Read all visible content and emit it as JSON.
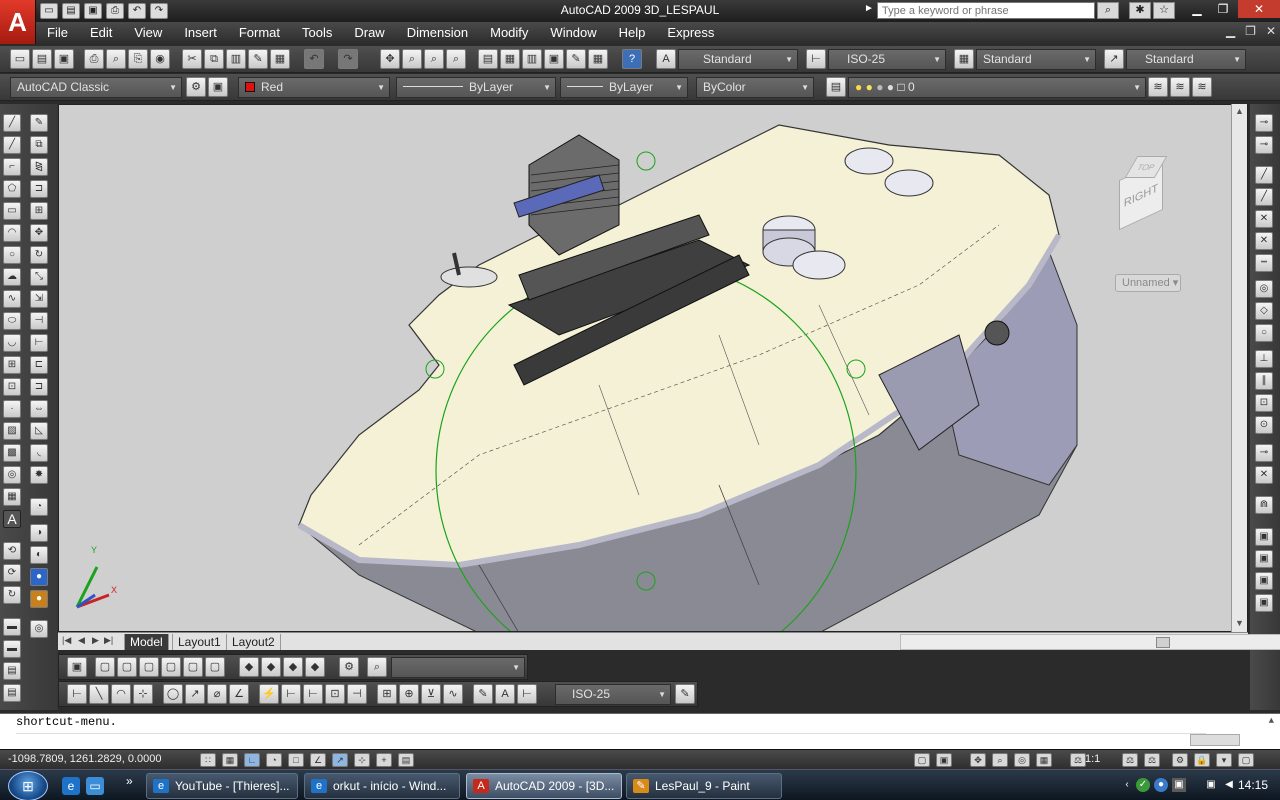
{
  "window": {
    "title": "AutoCAD 2009 3D_LESPAUL",
    "logo": "A",
    "search_placeholder": "Type a keyword or phrase"
  },
  "menu": [
    "File",
    "Edit",
    "View",
    "Insert",
    "Format",
    "Tools",
    "Draw",
    "Dimension",
    "Modify",
    "Window",
    "Help",
    "Express"
  ],
  "toolbar1": {
    "text_style": "Standard",
    "dim_style": "ISO-25",
    "table_style": "Standard",
    "multileader_style": "Standard"
  },
  "toolbar2": {
    "workspace": "AutoCAD Classic",
    "color": "Red",
    "color_hex": "#e01010",
    "linetype": "ByLayer",
    "lineweight": "ByLayer",
    "plotstyle": "ByColor",
    "layer": "0"
  },
  "viewport": {
    "background": "#cfcfcf",
    "model_color": "#f4f1d6",
    "side_color": "#8c8c9e",
    "orbit_color": "#1aa31a",
    "viewcube_face": "RIGHT",
    "viewcube_top": "TOP",
    "viewcube_menu": "Unnamed",
    "ucs_y": "Y",
    "ucs_x": "X"
  },
  "tabs": [
    "Model",
    "Layout1",
    "Layout2"
  ],
  "bottom_toolbar": {
    "view_combo": "",
    "dim_style": "ISO-25"
  },
  "command": {
    "history": "shortcut-menu.",
    "prompt": ""
  },
  "status": {
    "coords": "-1098.7809, 1261.2829, 0.0000",
    "annotation_scale": "1:1"
  },
  "taskbar": {
    "items": [
      {
        "label": "YouTube - [Thieres]...",
        "icon": "ie-icon"
      },
      {
        "label": "orkut - início - Wind...",
        "icon": "ie-icon"
      },
      {
        "label": "AutoCAD 2009 - [3D...",
        "icon": "autocad-icon"
      },
      {
        "label": "LesPaul_9 - Paint",
        "icon": "paint-icon"
      }
    ],
    "clock": "14:15"
  }
}
